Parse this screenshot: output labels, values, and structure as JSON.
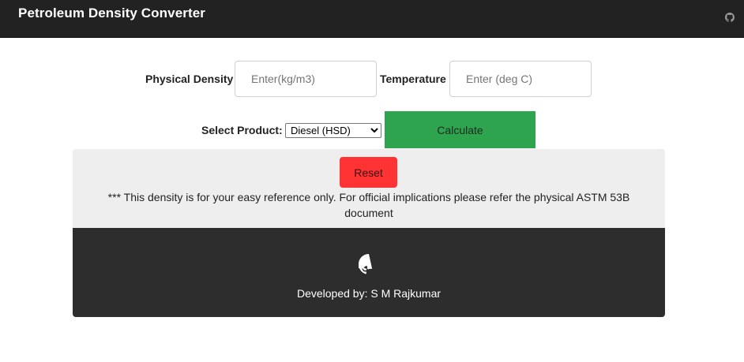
{
  "header": {
    "title": "Petroleum Density Converter",
    "github_icon": "github-icon"
  },
  "form": {
    "density_label": "Physical Density",
    "density_placeholder": "Enter(kg/m3)",
    "temperature_label": "Temperature",
    "temperature_placeholder": "Enter (deg C)",
    "product_label": "Select Product:",
    "product_selected": "Diesel (HSD)",
    "calculate_label": "Calculate",
    "reset_label": "Reset"
  },
  "disclaimer": "*** This density is for your easy reference only. For official implications please refer the physical ASTM 53B document",
  "footer": {
    "github_icon": "github-icon",
    "developer_text": "Developed by: S M Rajkumar"
  },
  "colors": {
    "header_bg": "#222222",
    "calculate_bg": "#2ea44f",
    "reset_bg": "#ff3333",
    "panel_bg": "#eeeeee",
    "footer_bg": "#2d2d2d"
  }
}
